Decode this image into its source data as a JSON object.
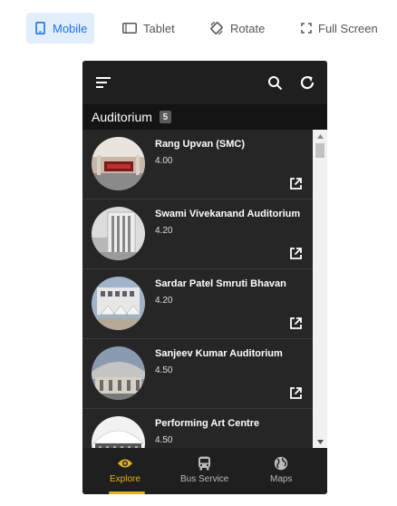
{
  "toolbar": {
    "mobile_label": "Mobile",
    "tablet_label": "Tablet",
    "rotate_label": "Rotate",
    "fullscreen_label": "Full Screen",
    "active": "mobile",
    "active_color": "#1a73e8"
  },
  "appbar": {
    "menu_icon": "menu-icon",
    "search_icon": "search-icon",
    "refresh_icon": "refresh-icon"
  },
  "section": {
    "title": "Auditorium",
    "count": "5"
  },
  "items": [
    {
      "name": "Rang Upvan (SMC)",
      "rating": "4.00"
    },
    {
      "name": "Swami Vivekanand Auditorium",
      "rating": "4.20"
    },
    {
      "name": "Sardar Patel Smruti Bhavan",
      "rating": "4.20"
    },
    {
      "name": "Sanjeev Kumar Auditorium",
      "rating": "4.50"
    },
    {
      "name": "Performing Art Centre",
      "rating": "4.50"
    }
  ],
  "bottom_nav": [
    {
      "label": "Explore",
      "icon": "eye-icon",
      "active": true
    },
    {
      "label": "Bus Service",
      "icon": "bus-icon",
      "active": false
    },
    {
      "label": "Maps",
      "icon": "globe-icon",
      "active": false
    }
  ],
  "colors": {
    "accent": "#e2b021",
    "background": "#262626",
    "appbar": "#1f1f1f"
  }
}
